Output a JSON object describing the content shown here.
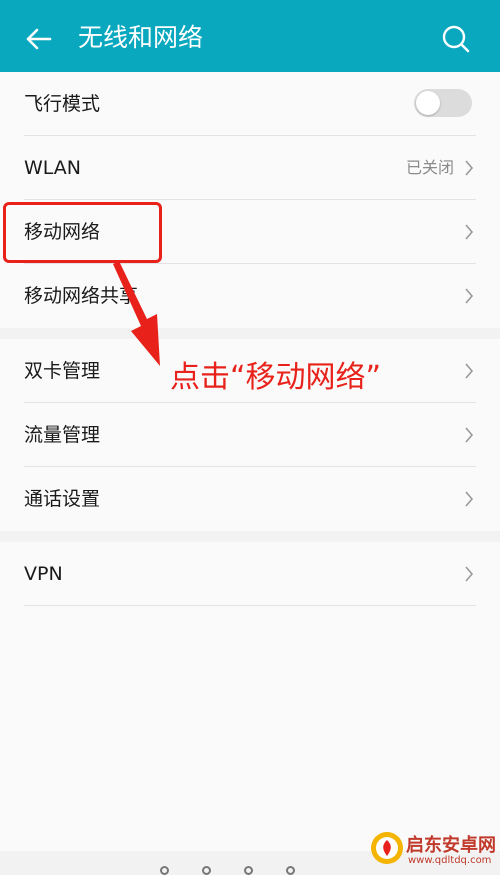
{
  "header": {
    "title": "无线和网络",
    "back_icon": "arrow-left-icon",
    "search_icon": "search-icon",
    "bg_color": "#0aa8bf"
  },
  "sections": [
    {
      "items": [
        {
          "label": "飞行模式",
          "control": "toggle",
          "toggle_on": false
        },
        {
          "label": "WLAN",
          "status": "已关闭",
          "control": "chevron"
        },
        {
          "label": "移动网络",
          "control": "chevron",
          "highlighted": true
        },
        {
          "label": "移动网络共享",
          "control": "chevron"
        }
      ]
    },
    {
      "items": [
        {
          "label": "双卡管理",
          "control": "chevron"
        },
        {
          "label": "流量管理",
          "control": "chevron"
        },
        {
          "label": "通话设置",
          "control": "chevron"
        }
      ]
    },
    {
      "items": [
        {
          "label": "VPN",
          "control": "chevron"
        }
      ]
    }
  ],
  "annotation": {
    "text": "点击“移动网络”",
    "color": "#e8221b"
  },
  "watermark": {
    "text": "启东安卓网",
    "url": "www.qdltdq.com"
  }
}
